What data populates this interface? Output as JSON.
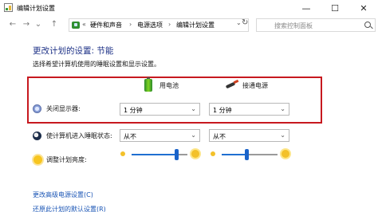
{
  "window": {
    "title": "编辑计划设置",
    "minimize": "—",
    "maximize": "☐",
    "close": "✕"
  },
  "nav": {
    "back": "←",
    "forward": "→",
    "dropdown": "⌄",
    "up": "↑"
  },
  "address": {
    "breadcrumbs": [
      "硬件和声音",
      "电源选项",
      "编辑计划设置"
    ],
    "separator": "›",
    "first_separator": "«",
    "dropdown": "⌄",
    "refresh": "↻"
  },
  "search": {
    "placeholder": "搜索控制面板"
  },
  "page": {
    "heading": "更改计划的设置: 节能",
    "description": "选择希望计算机使用的睡眠设置和显示设置。"
  },
  "columns": {
    "battery": "用电池",
    "plugged_in": "接通电源"
  },
  "settings": {
    "display_off": {
      "label": "关闭显示器:",
      "battery": "1 分钟",
      "plugged_in": "1 分钟"
    },
    "sleep": {
      "label": "使计算机进入睡眠状态:",
      "battery": "从不",
      "plugged_in": "从不"
    },
    "brightness": {
      "label": "调整计划亮度:",
      "battery_level": 0.8,
      "plugged_in_level": 0.45
    }
  },
  "select_chevron": "⌄",
  "links": {
    "advanced": "更改高级电源设置(C)",
    "restore": "还原此计划的默认设置(R)"
  },
  "colors": {
    "accent": "#1a63c9",
    "highlight_border": "#c7191f",
    "heading": "#1e3287",
    "link": "#1a55b5"
  }
}
